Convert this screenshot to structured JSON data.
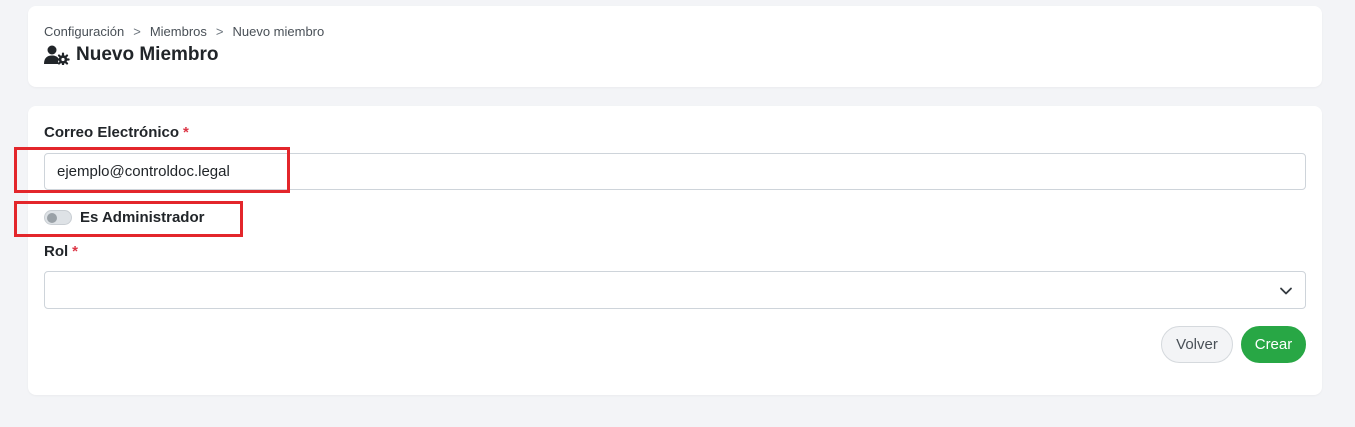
{
  "breadcrumb": {
    "items": [
      "Configuración",
      "Miembros",
      "Nuevo miembro"
    ],
    "separator": ">"
  },
  "header": {
    "title": "Nuevo Miembro",
    "icon": "user-gear-icon"
  },
  "form": {
    "email": {
      "label": "Correo Electrónico",
      "required_mark": "*",
      "value": "ejemplo@controldoc.legal"
    },
    "admin_switch": {
      "label": "Es Administrador",
      "checked": false
    },
    "rol": {
      "label": "Rol",
      "required_mark": "*",
      "selected": ""
    }
  },
  "actions": {
    "back_label": "Volver",
    "create_label": "Crear"
  },
  "colors": {
    "accent_green": "#28a745",
    "required_red": "#dc3545",
    "highlight_red": "#e3262b",
    "page_background": "#f3f4f7"
  }
}
